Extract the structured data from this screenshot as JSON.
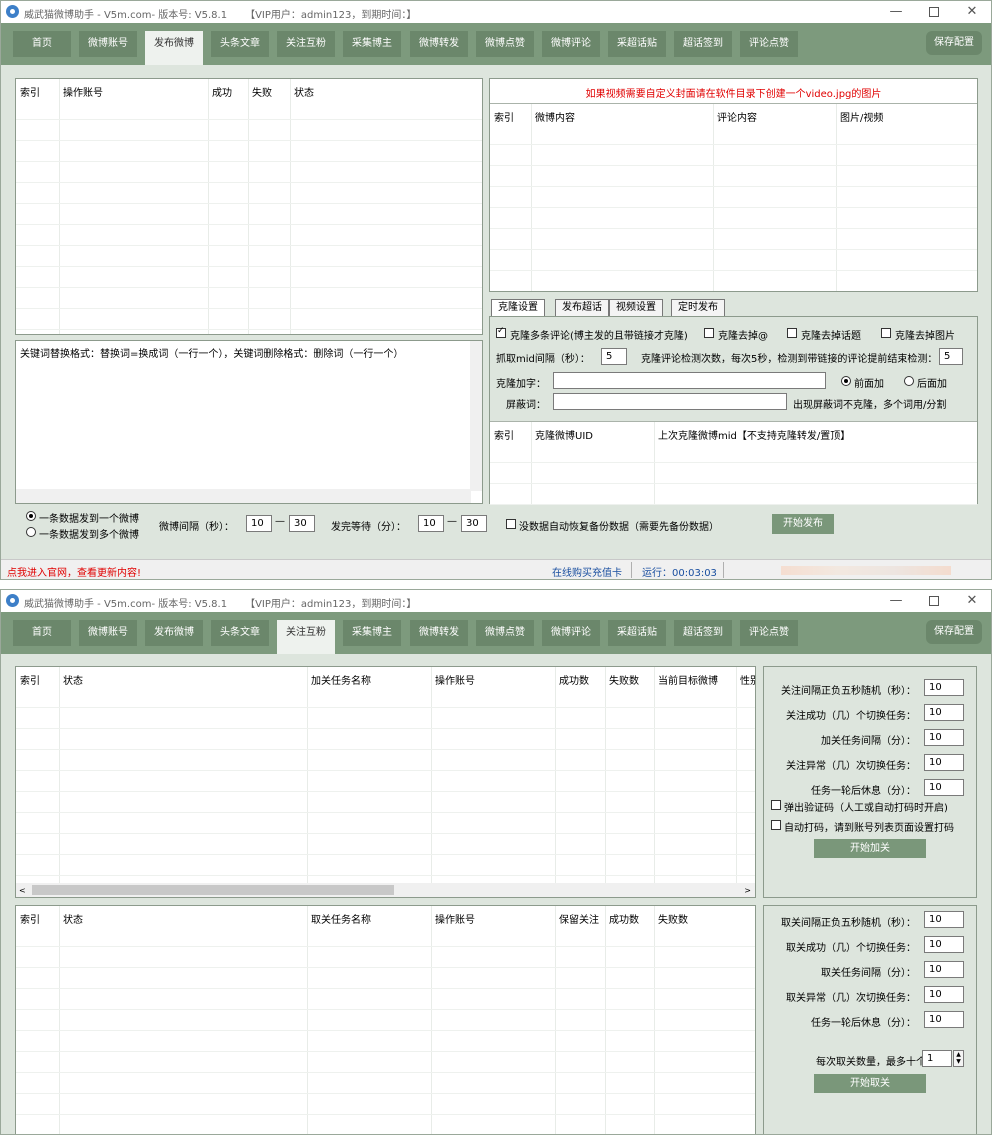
{
  "window1": {
    "title": {
      "app": "威武猫微博助手 - V5m.com- 版本号: V5.8.1",
      "vip": "【VIP用户：admin123，到期时间：】"
    },
    "controls": {
      "min": "—",
      "close": "✕"
    },
    "tabs": [
      "首页",
      "微博账号",
      "发布微博",
      "头条文章",
      "关注互粉",
      "采集博主",
      "微博转发",
      "微博点赞",
      "微博评论",
      "采超话贴",
      "超话签到",
      "评论点赞"
    ],
    "active_tab": "发布微博",
    "save_label": "保存配置",
    "accounts_table": {
      "headers": [
        "索引",
        "操作账号",
        "成功",
        "失败",
        "状态"
      ]
    },
    "keyword_hint": "关键词替换格式：替换词=换成词（一行一个），关键词删除格式：删除词（一行一个）",
    "video_notice": "如果视频需要自定义封面请在软件目录下创建一个video.jpg的图片",
    "posts_table": {
      "headers": [
        "索引",
        "微博内容",
        "评论内容",
        "图片/视频"
      ]
    },
    "subtabs": [
      "克隆设置",
      "发布超话",
      "视频设置",
      "定时发布"
    ],
    "clone": {
      "multi_comment": "克隆多条评论(博主发的且带链接才克隆)",
      "remove_at": "克隆去掉@",
      "remove_topic": "克隆去掉话题",
      "remove_image": "克隆去掉图片",
      "mid_interval_label": "抓取mid间隔（秒）：",
      "mid_interval": "5",
      "detect_label": "克隆评论检测次数，每次5秒，检测到带链接的评论提前结束检测：",
      "detect_count": "5",
      "prefix_label": "克隆加字：",
      "front_label": "前面加",
      "back_label": "后面加",
      "block_label": "屏蔽词：",
      "block_hint": "出现屏蔽词不克隆，多个词用/分割"
    },
    "clone_table": {
      "headers": [
        "索引",
        "克隆微博UID",
        "上次克隆微博mid【不支持克隆转发/置顶】"
      ]
    },
    "bottom": {
      "radio_one": "一条数据发到一个微博",
      "radio_many": "一条数据发到多个微博",
      "interval_label": "微博间隔（秒）：",
      "interval_min": "10",
      "interval_max": "30",
      "dash": "—",
      "wait_label": "发完等待（分）：",
      "wait_min": "10",
      "wait_max": "30",
      "restore_label": "没数据自动恢复备份数据（需要先备份数据）",
      "start_label": "开始发布"
    },
    "status": {
      "link": "点我进入官网，查看更新内容!",
      "buy": "在线购买充值卡",
      "runtime_label": "运行：",
      "runtime": "00:03:03"
    }
  },
  "window2": {
    "title": {
      "app": "威武猫微博助手 - V5m.com- 版本号: V5.8.1",
      "vip": "【VIP用户：admin123，到期时间：】"
    },
    "controls": {
      "min": "—",
      "close": "✕"
    },
    "tabs": [
      "首页",
      "微博账号",
      "发布微博",
      "头条文章",
      "关注互粉",
      "采集博主",
      "微博转发",
      "微博点赞",
      "微博评论",
      "采超话贴",
      "超话签到",
      "评论点赞"
    ],
    "active_tab": "关注互粉",
    "save_label": "保存配置",
    "follow_table": {
      "headers": [
        "索引",
        "状态",
        "加关任务名称",
        "操作账号",
        "成功数",
        "失败数",
        "当前目标微博",
        "性别"
      ]
    },
    "follow_settings": {
      "rows": [
        {
          "label": "关注间隔正负五秒随机（秒）：",
          "value": "10"
        },
        {
          "label": "关注成功（几）个切换任务：",
          "value": "10"
        },
        {
          "label": "加关任务间隔（分）：",
          "value": "10"
        },
        {
          "label": "关注异常（几）次切换任务：",
          "value": "10"
        },
        {
          "label": "任务一轮后休息（分）：",
          "value": "10"
        }
      ],
      "captcha_label": "弹出验证码（人工或自动打码时开启)",
      "auto_code_label": "自动打码，请到账号列表页面设置打码",
      "start_label": "开始加关"
    },
    "unfollow_table": {
      "headers": [
        "索引",
        "状态",
        "取关任务名称",
        "操作账号",
        "保留关注",
        "成功数",
        "失败数"
      ]
    },
    "unfollow_settings": {
      "rows": [
        {
          "label": "取关间隔正负五秒随机（秒）：",
          "value": "10"
        },
        {
          "label": "取关成功（几）个切换任务：",
          "value": "10"
        },
        {
          "label": "取关任务间隔（分）：",
          "value": "10"
        },
        {
          "label": "取关异常（几）次切换任务：",
          "value": "10"
        },
        {
          "label": "任务一轮后休息（分）：",
          "value": "10"
        }
      ],
      "max_label": "每次取关数量，最多十个：",
      "max_value": "1",
      "start_label": "开始取关"
    }
  }
}
